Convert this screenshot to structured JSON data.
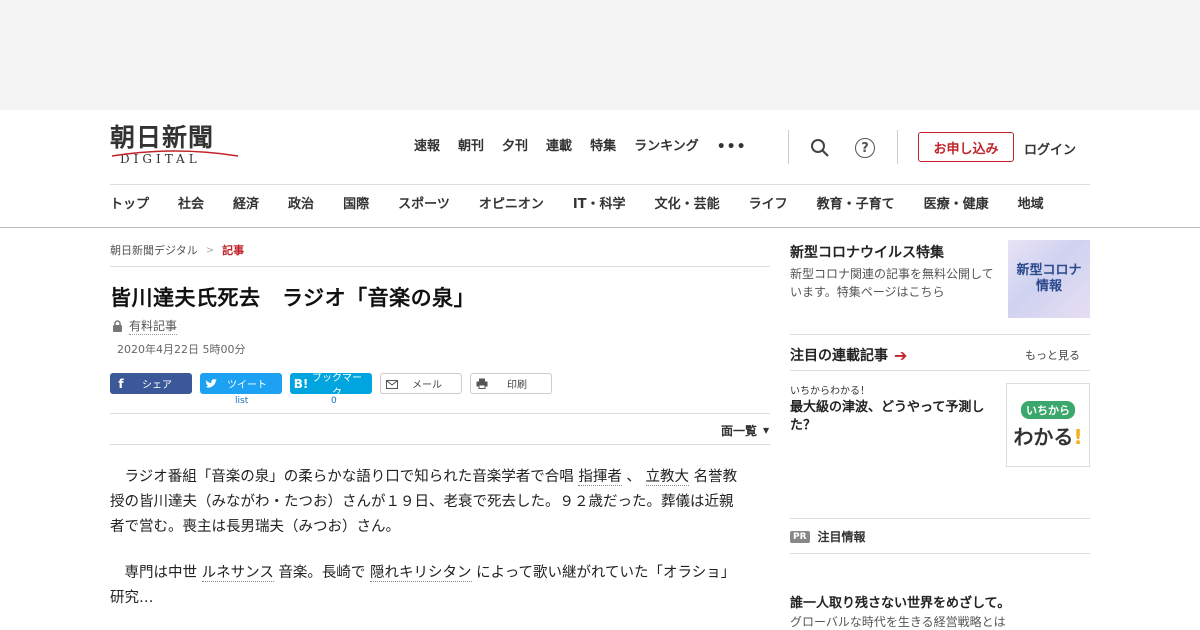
{
  "header": {
    "logo_main": "朝日新聞",
    "logo_sub": "DIGITAL",
    "top_nav": [
      "速報",
      "朝刊",
      "夕刊",
      "連載",
      "特集",
      "ランキング"
    ],
    "more_label": "•••",
    "help_label": "?",
    "apply_label": "お申し込み",
    "login_label": "ログイン"
  },
  "category_nav": [
    "トップ",
    "社会",
    "経済",
    "政治",
    "国際",
    "スポーツ",
    "オピニオン",
    "IT・科学",
    "文化・芸能",
    "ライフ",
    "教育・子育て",
    "医療・健康",
    "地域"
  ],
  "breadcrumb": {
    "home": "朝日新聞デジタル",
    "sep": ">",
    "current": "記事"
  },
  "article": {
    "headline": "皆川達夫氏死去　ラジオ「音楽の泉」",
    "paid_label": "有料記事",
    "date": "2020年4月22日 5時00分",
    "menu_label": "面一覧",
    "p1_a": "　ラジオ番組「音楽の泉」の柔らかな語り口で知られた音楽学者で合唱 ",
    "p1_link1": "指揮者",
    "p1_b": " 、 ",
    "p1_link2": "立教大",
    "p1_c": " 名誉教授の皆川達夫（みながわ・たつお）さんが１９日、老衰で死去した。９２歳だった。葬儀は近親者で営む。喪主は長男瑞夫（みつお）さん。",
    "p2_a": "　専門は中世 ",
    "p2_link1": "ルネサンス",
    "p2_b": " 音楽。長崎で ",
    "p2_link2": "隠れキリシタン",
    "p2_c": " によって歌い継がれていた「オラショ」研究…"
  },
  "share": {
    "facebook": "シェア",
    "twitter": "ツイート",
    "hatena": "ブックマーク",
    "hatena_icon": "B!",
    "mail": "メール",
    "print": "印刷",
    "twitter_count": "list",
    "hatena_count": "0"
  },
  "sidebar": {
    "corona_title": "新型コロナウイルス特集",
    "corona_desc": "新型コロナ関連の記事を無料公開しています。特集ページはこちら",
    "corona_thumb_line1": "新型コロナ",
    "corona_thumb_line2": "情報",
    "series_title": "注目の連載記事",
    "series_more": "もっと見る",
    "series_kicker": "いちからわかる！",
    "series_head": "最大級の津波、どうやって予測した？",
    "ichikara_badge": "いちから",
    "ichikara_big": "わかる",
    "ichikara_ex": "!",
    "pr_tag": "PR",
    "pr_label": "注目情報",
    "promo_head": "誰一人取り残さない世界をめざして。",
    "promo_sub": "グローバルな時代を生きる経営戦略とは"
  },
  "colors": {
    "accent_red": "#c0242a",
    "facebook": "#3b5998",
    "twitter": "#1da1f2",
    "hatena": "#00a4de"
  }
}
